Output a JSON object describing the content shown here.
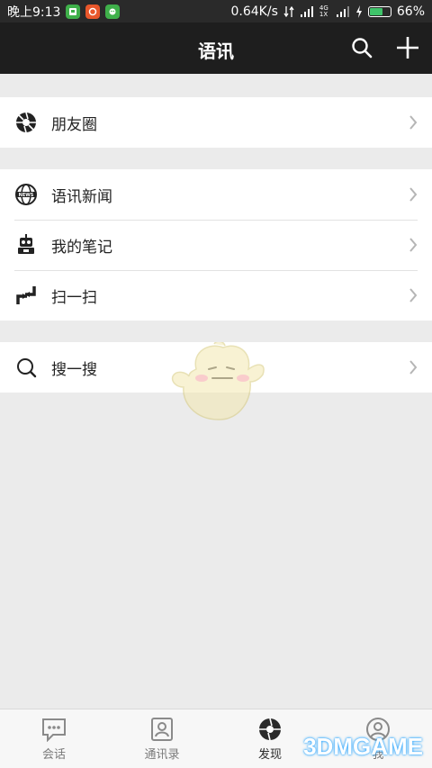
{
  "status_bar": {
    "time": "晚上9:13",
    "speed": "0.64K/s",
    "signal": "4G 1X",
    "battery": "66%",
    "battery_level": 0.66
  },
  "header": {
    "title": "语讯"
  },
  "groups": [
    {
      "items": [
        {
          "label": "朋友圈",
          "icon": "aperture-icon"
        }
      ]
    },
    {
      "items": [
        {
          "label": "语讯新闻",
          "icon": "news-globe-icon"
        },
        {
          "label": "我的笔记",
          "icon": "robot-icon"
        },
        {
          "label": "扫一扫",
          "icon": "scan-icon"
        }
      ]
    },
    {
      "items": [
        {
          "label": "搜一搜",
          "icon": "search-icon"
        }
      ]
    }
  ],
  "tabs": [
    {
      "label": "会话",
      "icon": "chat-icon"
    },
    {
      "label": "通讯录",
      "icon": "contacts-icon"
    },
    {
      "label": "发现",
      "icon": "discover-icon"
    },
    {
      "label": "我",
      "icon": "profile-icon"
    }
  ],
  "watermark": "3DMGAME",
  "colors": {
    "header_bg": "#1e1e1e",
    "page_bg": "#ebebeb",
    "battery_green": "#3fc46a"
  }
}
